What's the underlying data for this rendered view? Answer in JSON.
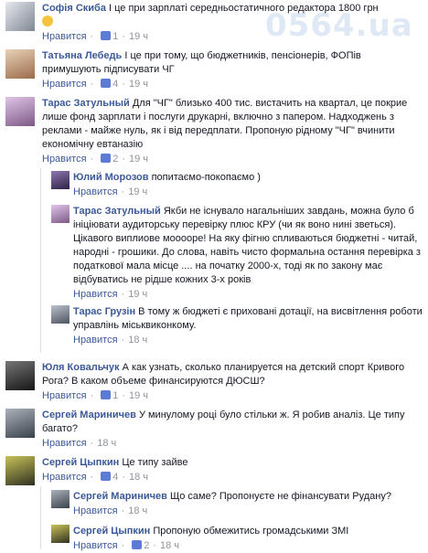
{
  "watermark": "0564.ua",
  "like_label": "Нравится",
  "comments": [
    {
      "author": "Софія Скиба",
      "text": "І це при зарплаті середньостатичного редактора 1800 грн",
      "emoji": "smile",
      "likes": "1",
      "time": "19 ч"
    },
    {
      "author": "Татьяна Лебедь",
      "text": "І це при тому, що бюджетників, пенсіонерів, ФОПів примушують підписувати ЧГ",
      "tags": [
        "пенсіонерів",
        "ФОП"
      ],
      "likes": "4",
      "time": "19 ч"
    },
    {
      "author": "Тарас Затульный",
      "text": "Для \"ЧГ\" близько 400 тис. вистачить на квартал, це покрие лише фонд зарплати і послуги друкарні, включно з папером. Надходжень з реклами - майже нуль, як і від передплати. Пропоную рідному \"ЧГ\" вчинити економічну евтаназію",
      "likes": "2",
      "time": "19 ч"
    },
    {
      "author": "Юлий Морозов",
      "text": "попитаємо-покопаємо )",
      "time": "19 ч"
    },
    {
      "author": "Тарас Затульный",
      "text": "Якби не існувало нагальніших завдань, можна було б ініціювати аудиторську перевірку плюс КРУ (чи як воно нині зветься). Цікавого виплиове мооооре! На яку фігню спливаються бюджетні - читай, народні - грошики. До слова, навіть чисто формальна остання перевірка з податкової мала місце .... на початку 2000-х, тоді як по закону має відбуватись не рідше кожних 3-х років",
      "time": "19 ч"
    },
    {
      "author": "Тарас Грузін",
      "text": "В тому ж бюджеті є приховані дотації, на висвітлення роботи управлінь міськвиконкому.",
      "time": "18 ч"
    },
    {
      "author": "Юля Ковальчук",
      "text": "А как узнать, сколько планируется на детский спорт Кривого Рога? В каком объеме финансируются ДЮСШ?",
      "likes": "1",
      "time": "19 ч"
    },
    {
      "author": "Сергей Мариничев",
      "text": "У минулому році було стільки ж. Я робив аналіз. Це типу багато?",
      "time": "18 ч"
    },
    {
      "author": "Сергей Цыпкин",
      "text": "Це типу зайве",
      "likes": "4",
      "time": "18 ч"
    },
    {
      "author": "Сергей Мариничев",
      "text": "Що саме? Пропонуєте не фінансувати Рудану?",
      "time": "18 ч"
    },
    {
      "author": "Сергей Цыпкин",
      "text": "Пропоную обмежитись громадськими ЗМІ",
      "likes": "2",
      "time": "18 ч"
    }
  ]
}
